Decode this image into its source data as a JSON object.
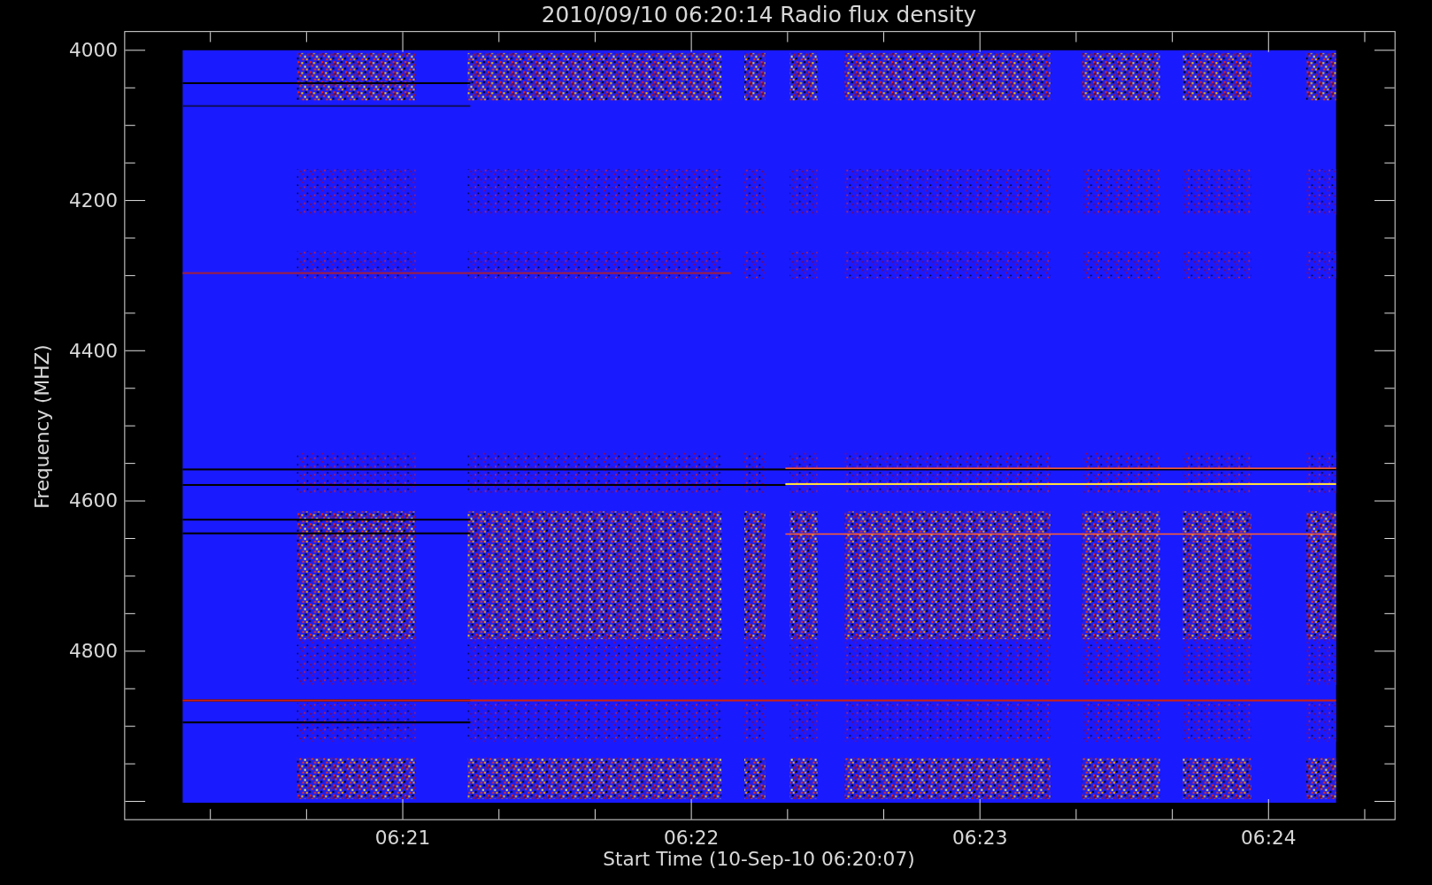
{
  "plot": {
    "title": "2010/09/10 06:20:14 Radio flux density",
    "ylabel": "Frequency (MHZ)",
    "xlabel": "Start Time (10-Sep-10 06:20:07)",
    "yticks": [
      "4000",
      "4200",
      "4400",
      "4600",
      "4800"
    ],
    "xticks": [
      "06:21",
      "06:22",
      "06:23",
      "06:24"
    ]
  }
}
